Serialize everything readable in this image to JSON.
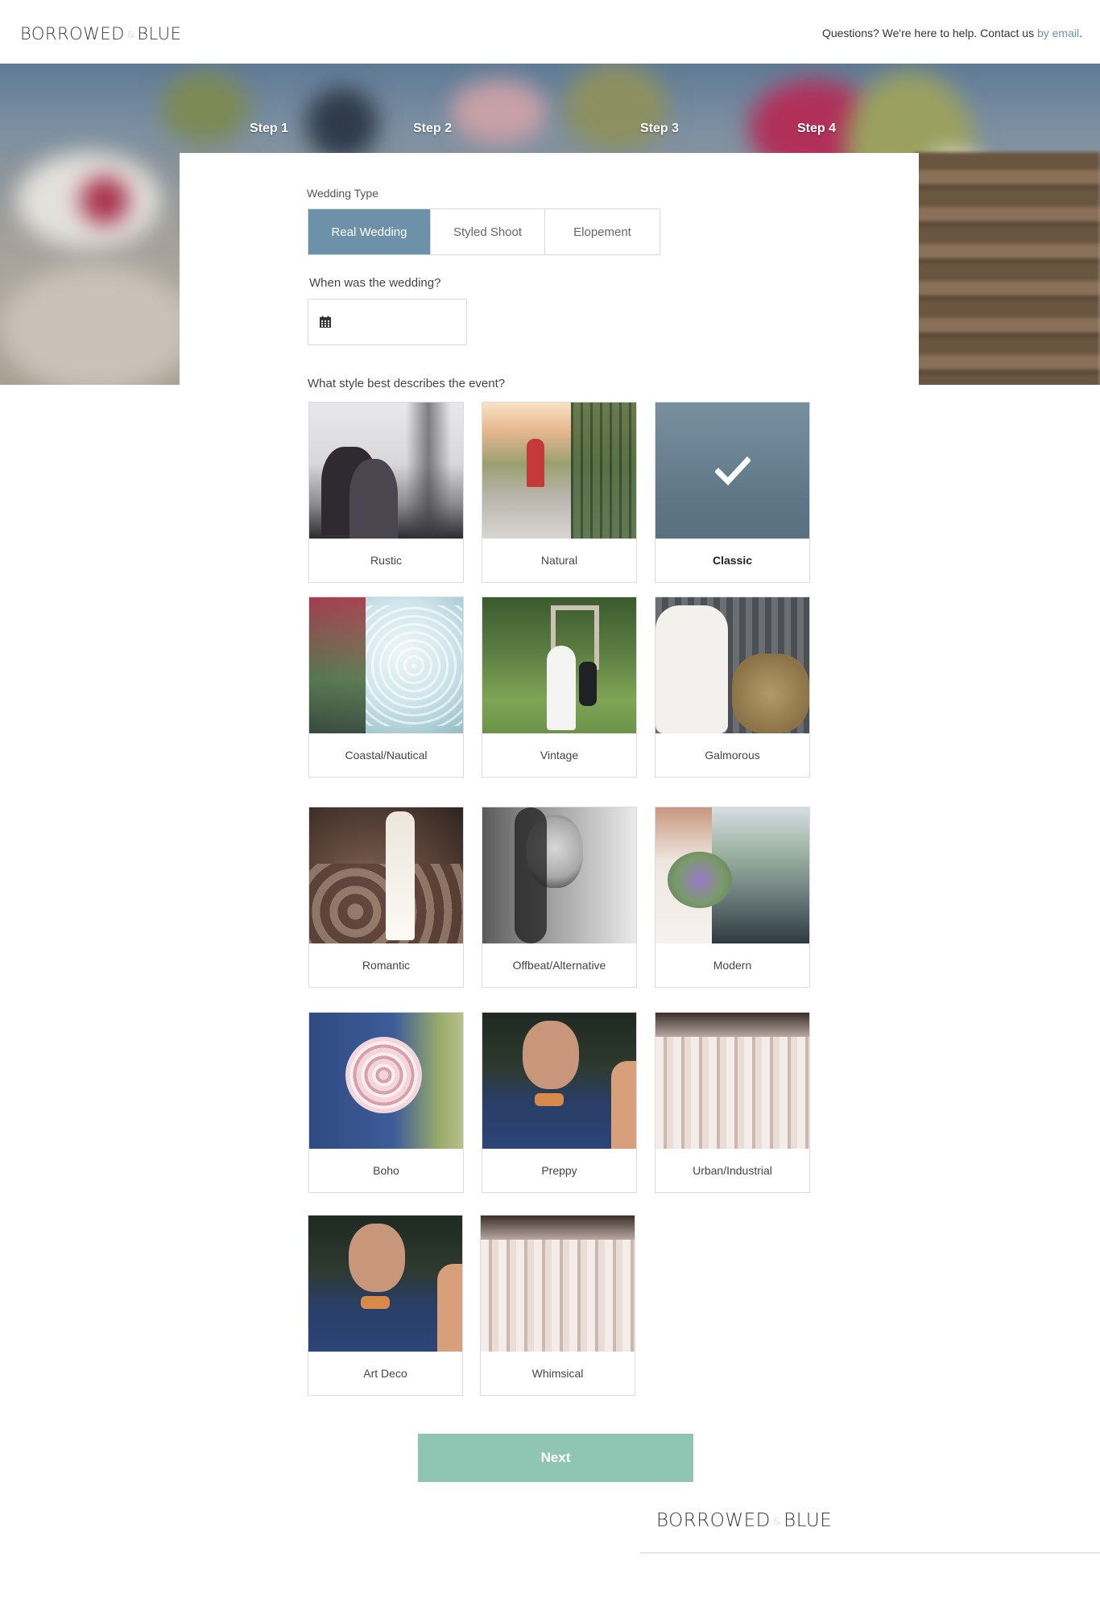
{
  "brand": {
    "logo_left": "BORROWED",
    "logo_amp": "&",
    "logo_right": "BLUE"
  },
  "header": {
    "help_text": "Questions? We're here to help. Contact us",
    "help_link": "by email",
    "help_end": "."
  },
  "steps": [
    "Step 1",
    "Step 2",
    "Step 3",
    "Step 4"
  ],
  "form": {
    "wedding_type_label": "Wedding Type",
    "wedding_types": [
      "Real Wedding",
      "Styled Shoot",
      "Elopement"
    ],
    "wedding_type_selected": "Real Wedding",
    "date_label": "When was the wedding?",
    "date_value": "",
    "style_label": "What style best describes the event?",
    "styles": [
      {
        "label": "Rustic",
        "selected": false
      },
      {
        "label": "Natural",
        "selected": false
      },
      {
        "label": "Classic",
        "selected": true
      },
      {
        "label": "Coastal/Nautical",
        "selected": false
      },
      {
        "label": "Vintage",
        "selected": false
      },
      {
        "label": "Galmorous",
        "selected": false
      },
      {
        "label": "Romantic",
        "selected": false
      },
      {
        "label": "Offbeat/Alternative",
        "selected": false
      },
      {
        "label": "Modern",
        "selected": false
      },
      {
        "label": "Boho",
        "selected": false
      },
      {
        "label": "Preppy",
        "selected": false
      },
      {
        "label": "Urban/Industrial",
        "selected": false
      },
      {
        "label": "Art Deco",
        "selected": false
      },
      {
        "label": "Whimsical",
        "selected": false
      }
    ],
    "next_label": "Next"
  },
  "icons": {
    "calendar": "calendar-icon",
    "check": "check-icon"
  },
  "colors": {
    "accent": "#6d91a8",
    "next_button": "#8fc5b3",
    "link": "#6f93a8"
  }
}
